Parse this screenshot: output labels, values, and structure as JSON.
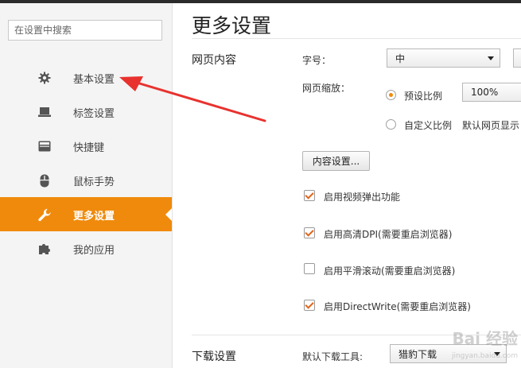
{
  "sidebar": {
    "search_placeholder": "在设置中搜索",
    "items": [
      {
        "label": "基本设置",
        "icon": "gear-icon"
      },
      {
        "label": "标签设置",
        "icon": "laptop-icon"
      },
      {
        "label": "快捷键",
        "icon": "keyboard-icon"
      },
      {
        "label": "鼠标手势",
        "icon": "mouse-icon"
      },
      {
        "label": "更多设置",
        "icon": "wrench-icon",
        "active": true
      },
      {
        "label": "我的应用",
        "icon": "puzzle-icon"
      }
    ]
  },
  "main": {
    "title": "更多设置",
    "web_content": {
      "section_label": "网页内容",
      "font_size_label": "字号：",
      "font_size_value": "中",
      "zoom_label": "网页缩放：",
      "preset_ratio_label": "预设比例",
      "preset_ratio_value": "100%",
      "custom_ratio_label": "自定义比例",
      "default_display_label": "默认网页显示",
      "content_settings_button": "内容设置..."
    },
    "checkboxes": [
      {
        "label": "启用视频弹出功能",
        "checked": true
      },
      {
        "label": "启用高清DPI(需要重启浏览器)",
        "checked": true
      },
      {
        "label": "启用平滑滚动(需要重启浏览器)",
        "checked": false
      },
      {
        "label": "启用DirectWrite(需要重启浏览器)",
        "checked": true
      }
    ],
    "download": {
      "section_label": "下载设置",
      "tool_label": "默认下载工具:",
      "tool_value": "猎豹下载"
    }
  },
  "watermark": {
    "text": "Bai 经验",
    "sub": "jingyan.baidu.com"
  },
  "colors": {
    "accent": "#f08a0c",
    "annotation_arrow": "#e8322e"
  }
}
